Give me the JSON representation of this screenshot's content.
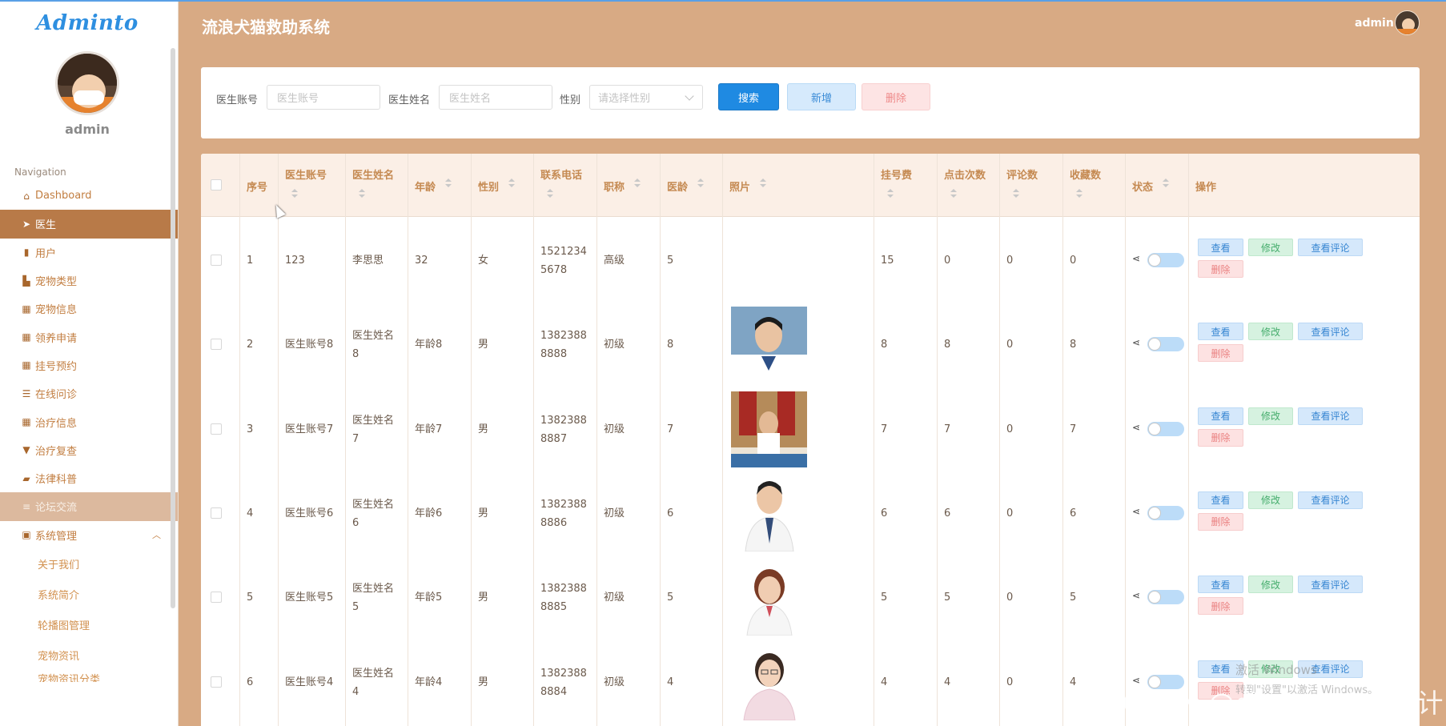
{
  "app": {
    "logo": "Adminto",
    "title": "流浪犬猫救助系统"
  },
  "header": {
    "username": "admin"
  },
  "sidebar": {
    "username": "admin",
    "nav_title": "Navigation",
    "items": [
      {
        "label": "Dashboard",
        "icon": "home-icon"
      },
      {
        "label": "医生",
        "icon": "paper-plane-icon",
        "active": true
      },
      {
        "label": "用户",
        "icon": "bar-chart-icon"
      },
      {
        "label": "宠物类型",
        "icon": "book-icon"
      },
      {
        "label": "宠物信息",
        "icon": "grid-icon"
      },
      {
        "label": "领养申请",
        "icon": "grid-icon"
      },
      {
        "label": "挂号预约",
        "icon": "grid-icon"
      },
      {
        "label": "在线问诊",
        "icon": "sliders-icon"
      },
      {
        "label": "治疗信息",
        "icon": "grid-icon"
      },
      {
        "label": "治疗复查",
        "icon": "stamp-icon"
      },
      {
        "label": "法律科普",
        "icon": "ticket-icon"
      },
      {
        "label": "论坛交流",
        "icon": "list-icon"
      },
      {
        "label": "系统管理",
        "icon": "clipboard-icon"
      }
    ],
    "sub_items": [
      "关于我们",
      "系统简介",
      "轮播图管理",
      "宠物资讯",
      "宠物资讯分类"
    ]
  },
  "search": {
    "account_label": "医生账号",
    "account_placeholder": "医生账号",
    "name_label": "医生姓名",
    "name_placeholder": "医生姓名",
    "gender_label": "性别",
    "gender_placeholder": "请选择性别",
    "search_btn": "搜索",
    "add_btn": "新增",
    "delete_btn": "删除"
  },
  "table": {
    "columns": [
      "序号",
      "医生账号",
      "医生姓名",
      "年龄",
      "性别",
      "联系电话",
      "职称",
      "医龄",
      "照片",
      "挂号费",
      "点击次数",
      "评论数",
      "收藏数",
      "状态",
      "操作"
    ],
    "actions": {
      "view": "查看",
      "edit": "修改",
      "comment": "查看评论",
      "delete": "删除"
    },
    "rows": [
      {
        "no": "1",
        "account": "123",
        "name": [
          "李思思"
        ],
        "age": "32",
        "gender": "女",
        "phone": [
          "1521234",
          "5678"
        ],
        "title": "高级",
        "years": "5",
        "photo": "",
        "fee": "15",
        "clicks": "0",
        "comments": "0",
        "favorites": "0"
      },
      {
        "no": "2",
        "account": "医生账号8",
        "name": [
          "医生姓名",
          "8"
        ],
        "age": "年龄8",
        "gender": "男",
        "phone": [
          "1382388",
          "8888"
        ],
        "title": "初级",
        "years": "8",
        "photo": "doctor-photo",
        "fee": "8",
        "clicks": "8",
        "comments": "0",
        "favorites": "8"
      },
      {
        "no": "3",
        "account": "医生账号7",
        "name": [
          "医生姓名",
          "7"
        ],
        "age": "年龄7",
        "gender": "男",
        "phone": [
          "1382388",
          "8887"
        ],
        "title": "初级",
        "years": "7",
        "photo": "doctor-photo",
        "fee": "7",
        "clicks": "7",
        "comments": "0",
        "favorites": "7"
      },
      {
        "no": "4",
        "account": "医生账号6",
        "name": [
          "医生姓名",
          "6"
        ],
        "age": "年龄6",
        "gender": "男",
        "phone": [
          "1382388",
          "8886"
        ],
        "title": "初级",
        "years": "6",
        "photo": "doctor-photo",
        "fee": "6",
        "clicks": "6",
        "comments": "0",
        "favorites": "6"
      },
      {
        "no": "5",
        "account": "医生账号5",
        "name": [
          "医生姓名",
          "5"
        ],
        "age": "年龄5",
        "gender": "男",
        "phone": [
          "1382388",
          "8885"
        ],
        "title": "初级",
        "years": "5",
        "photo": "doctor-photo",
        "fee": "5",
        "clicks": "5",
        "comments": "0",
        "favorites": "5"
      },
      {
        "no": "6",
        "account": "医生账号4",
        "name": [
          "医生姓名",
          "4"
        ],
        "age": "年龄4",
        "gender": "男",
        "phone": [
          "1382388",
          "8884"
        ],
        "title": "初级",
        "years": "4",
        "photo": "doctor-photo",
        "fee": "4",
        "clicks": "4",
        "comments": "0",
        "favorites": "4"
      }
    ]
  },
  "overlay": {
    "watermark_line1": "激活 Windows",
    "watermark_line2": "转到\"设置\"以激活 Windows。",
    "csdn": "CSDN @django 毕业设计"
  },
  "colors": {
    "header_bg": "#d8aa84",
    "active_nav": "#b87a48",
    "primary": "#1f8ae2"
  }
}
